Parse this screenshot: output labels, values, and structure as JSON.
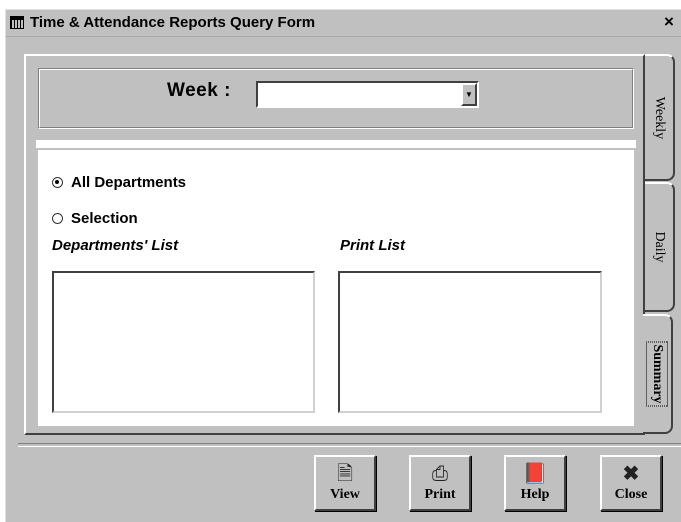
{
  "window": {
    "title": "Time & Attendance Reports Query Form"
  },
  "week": {
    "label": "Week :",
    "value": ""
  },
  "radios": {
    "all_departments": "All Departments",
    "selection": "Selection",
    "selected": "all_departments"
  },
  "lists": {
    "departments_label": "Departments' List",
    "print_label": "Print List"
  },
  "tabs": [
    {
      "label": "Weekly"
    },
    {
      "label": "Daily"
    },
    {
      "label": "Summary"
    }
  ],
  "buttons": {
    "view": "View",
    "print": "Print",
    "help": "Help",
    "close": "Close"
  },
  "icons": {
    "app": "form-icon",
    "view": "magnifier-document-icon",
    "print": "printer-icon",
    "help": "book-icon",
    "close": "close-x-icon"
  }
}
